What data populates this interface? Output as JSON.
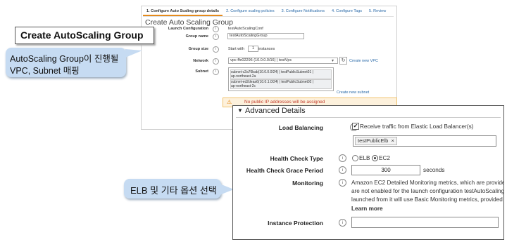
{
  "wizard": {
    "steps": [
      "1. Configure Auto Scaling group details",
      "2. Configure scaling policies",
      "3. Configure Notifications",
      "4. Configure Tags",
      "5. Review"
    ],
    "page_title": "Create Auto Scaling Group",
    "launch_configuration": {
      "label": "Launch Configuration",
      "value": "testAutoScalingConf"
    },
    "group_name": {
      "label": "Group name",
      "value": "testAutoScalingGroup"
    },
    "group_size": {
      "label": "Group size",
      "prefix": "Start with",
      "value": "1",
      "suffix": "instances"
    },
    "network": {
      "label": "Network",
      "value": "vpc-ffe02296 (10.0.0.0/16) | testVpc",
      "create_link": "Create new VPC"
    },
    "subnet": {
      "label": "Subnet",
      "items": [
        {
          "line1": "subnet-c2a76bab(10.0.0.0/24) | testPublicSubnet01 |",
          "line2": "ap-northeast-2a"
        },
        {
          "line1": "subnet-ed2deaa6(10.0.1.0/24) | testPublicSubnet02 |",
          "line2": "ap-northeast-2c"
        }
      ],
      "create_link": "Create new subnet"
    },
    "warning": "No public IP addresses will be assigned"
  },
  "callouts": {
    "title": "Create AutoScaling Group",
    "mapping_line1": "AutoScaling Group이 진행될",
    "mapping_line2": "VPC, Subnet 매핑",
    "elb_note": "ELB 및 기타 옵션 선택"
  },
  "advanced": {
    "header": "Advanced Details",
    "load_balancing": {
      "label": "Load Balancing",
      "checkbox_label": "Receive traffic from Elastic Load Balancer(s)",
      "checked": true,
      "token": "testPublicElb"
    },
    "health_check_type": {
      "label": "Health Check Type",
      "options": [
        "ELB",
        "EC2"
      ],
      "selected": "EC2"
    },
    "grace_period": {
      "label": "Health Check Grace Period",
      "value": "300",
      "unit": "seconds"
    },
    "monitoring": {
      "label": "Monitoring",
      "lines": [
        "Amazon EC2 Detailed Monitoring metrics, which are provided",
        "are not enabled for the launch configuration testAutoScaling",
        "launched from it will use Basic Monitoring metrics, provided"
      ],
      "link": "Learn more"
    },
    "instance_protection": {
      "label": "Instance Protection",
      "value": ""
    }
  },
  "colors": {
    "callout_bg": "#c6dbf2",
    "link": "#2a6aa8",
    "active_tab": "#e58a1a",
    "warning_bg": "#fdf1dc"
  }
}
